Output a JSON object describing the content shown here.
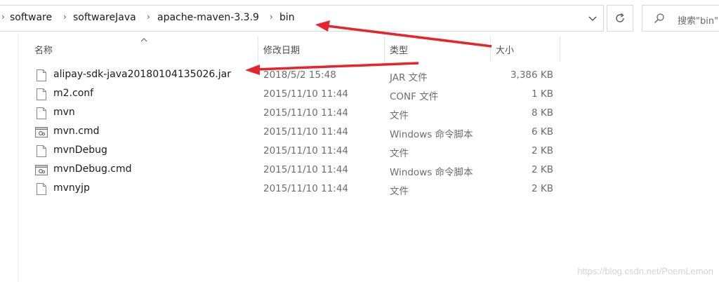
{
  "breadcrumb": {
    "separator_glyph": "›",
    "items": [
      "software",
      "softwareJava",
      "apache-maven-3.3.9",
      "bin"
    ]
  },
  "search": {
    "placeholder": "搜索\"bin\""
  },
  "columns": {
    "name": "名称",
    "date": "修改日期",
    "type": "类型",
    "size": "大小"
  },
  "files": [
    {
      "name": "alipay-sdk-java20180104135026.jar",
      "date": "2018/5/2 15:48",
      "type": "JAR 文件",
      "size": "3,386 KB",
      "icon": "file-icon"
    },
    {
      "name": "m2.conf",
      "date": "2015/11/10 11:44",
      "type": "CONF 文件",
      "size": "1 KB",
      "icon": "file-icon"
    },
    {
      "name": "mvn",
      "date": "2015/11/10 11:44",
      "type": "文件",
      "size": "8 KB",
      "icon": "file-icon"
    },
    {
      "name": "mvn.cmd",
      "date": "2015/11/10 11:44",
      "type": "Windows 命令脚本",
      "size": "6 KB",
      "icon": "cmd-script-icon"
    },
    {
      "name": "mvnDebug",
      "date": "2015/11/10 11:44",
      "type": "文件",
      "size": "2 KB",
      "icon": "file-icon"
    },
    {
      "name": "mvnDebug.cmd",
      "date": "2015/11/10 11:44",
      "type": "Windows 命令脚本",
      "size": "2 KB",
      "icon": "cmd-script-icon"
    },
    {
      "name": "mvnyjp",
      "date": "2015/11/10 11:44",
      "type": "文件",
      "size": "2 KB",
      "icon": "file-icon"
    }
  ],
  "watermark": "https://blog.csdn.net/PoemLemon",
  "annotation_color": "#e8232b"
}
